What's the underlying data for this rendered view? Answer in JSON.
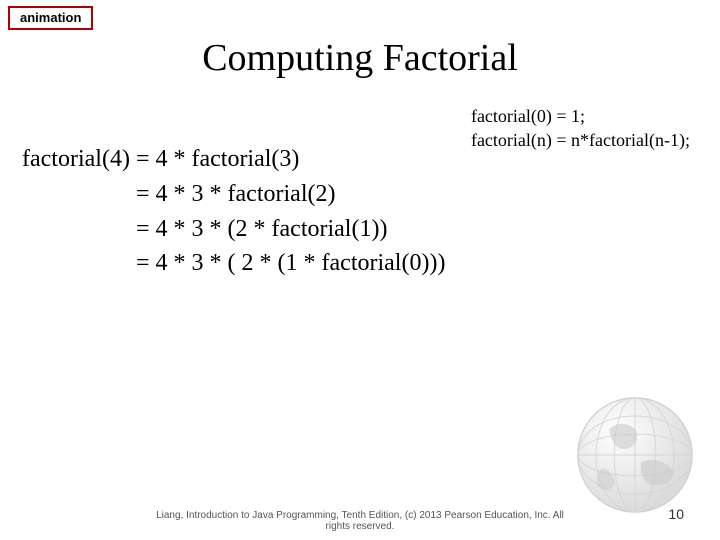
{
  "badge": {
    "label": "animation"
  },
  "title": "Computing Factorial",
  "definitions": {
    "base": "factorial(0) = 1;",
    "recursive": "factorial(n) = n*factorial(n-1);"
  },
  "expansion": {
    "line1_lhs": "factorial(4) ",
    "line1_rhs": "= 4 * factorial(3)",
    "line2": "= 4 * 3 * factorial(2)",
    "line3": "= 4 * 3 * (2 * factorial(1))",
    "line4": "= 4 * 3 * ( 2 * (1 * factorial(0)))",
    "indent": "                   "
  },
  "footer": {
    "line1": "Liang, Introduction to Java Programming, Tenth Edition, (c) 2013 Pearson Education, Inc. All",
    "line2": "rights reserved."
  },
  "page_number": "10"
}
